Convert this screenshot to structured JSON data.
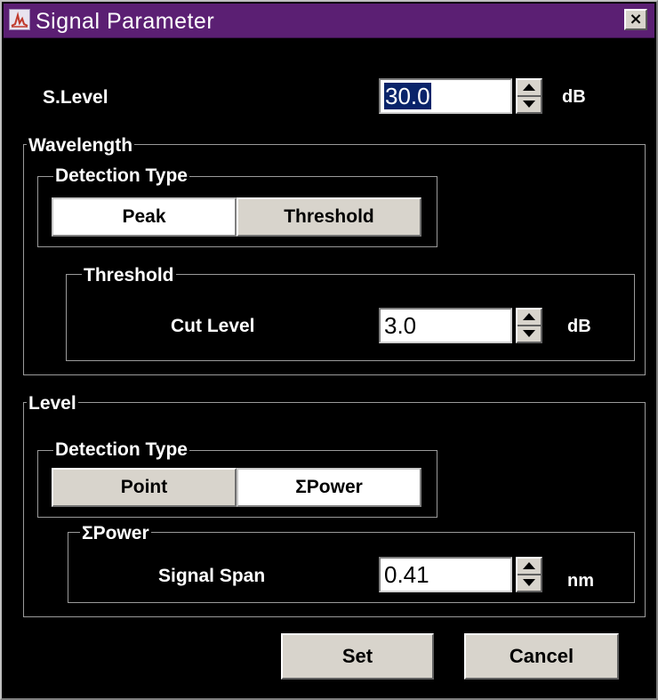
{
  "window": {
    "title": "Signal Parameter",
    "close_glyph": "×"
  },
  "s_level": {
    "label": "S.Level",
    "value": "30.0",
    "unit": "dB"
  },
  "wavelength": {
    "group_label": "Wavelength",
    "detection_type": {
      "label": "Detection Type",
      "options": [
        "Peak",
        "Threshold"
      ],
      "selected": "Peak"
    },
    "threshold": {
      "group_label": "Threshold",
      "cut_level_label": "Cut Level",
      "cut_level_value": "3.0",
      "unit": "dB"
    }
  },
  "level": {
    "group_label": "Level",
    "detection_type": {
      "label": "Detection Type",
      "options": [
        "Point",
        "ΣPower"
      ],
      "selected": "ΣPower"
    },
    "sigma_power": {
      "group_label": "ΣPower",
      "signal_span_label": "Signal Span",
      "signal_span_value": "0.41",
      "unit": "nm"
    }
  },
  "buttons": {
    "set": "Set",
    "cancel": "Cancel"
  },
  "colors": {
    "titlebar": "#5b1f73",
    "background": "#000000",
    "selection": "#0a246a",
    "button_face": "#d8d4cc"
  }
}
